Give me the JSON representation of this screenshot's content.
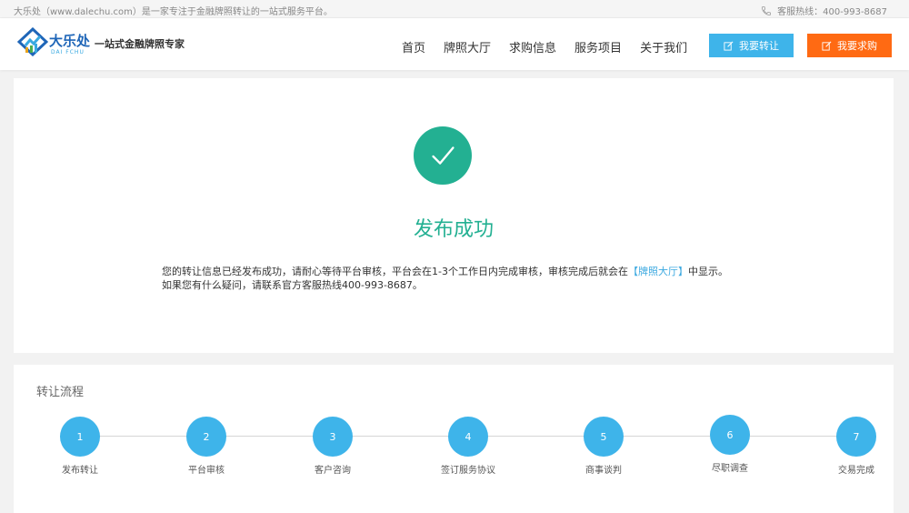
{
  "topbar": {
    "intro": "大乐处（www.dalechu.com）是一家专注于金融牌照转让的一站式服务平台。",
    "hotline": "客服热线：400-993-8687",
    "phone_icon": "phone-icon"
  },
  "header": {
    "brand": "大乐处",
    "brand_sub": "DAI FCHU",
    "slogan": "一站式金融牌照专家",
    "nav": [
      "首页",
      "牌照大厅",
      "求购信息",
      "服务项目",
      "关于我们"
    ],
    "btn_transfer": "我要转让",
    "btn_buy": "我要求购"
  },
  "success": {
    "title": "发布成功",
    "line1_a": "您的转让信息已经发布成功，请耐心等待平台审核，平台会在1-3个工作日内完成审核，审核完成后就会在",
    "line1_link": "【牌照大厅】",
    "line1_b": "中显示。",
    "line2": "如果您有什么疑问，请联系官方客服热线400-993-8687。"
  },
  "flow": {
    "title": "转让流程",
    "steps": [
      {
        "num": "1",
        "label": "发布转让"
      },
      {
        "num": "2",
        "label": "平台审核"
      },
      {
        "num": "3",
        "label": "客户咨询"
      },
      {
        "num": "4",
        "label": "签订服务协议"
      },
      {
        "num": "5",
        "label": "商事谈判"
      },
      {
        "num": "6",
        "label": "尽职调查"
      },
      {
        "num": "7",
        "label": "交易完成"
      }
    ]
  },
  "colors": {
    "accent_blue": "#3eb4ea",
    "accent_orange": "#ff6a13",
    "success_green": "#23b092"
  }
}
